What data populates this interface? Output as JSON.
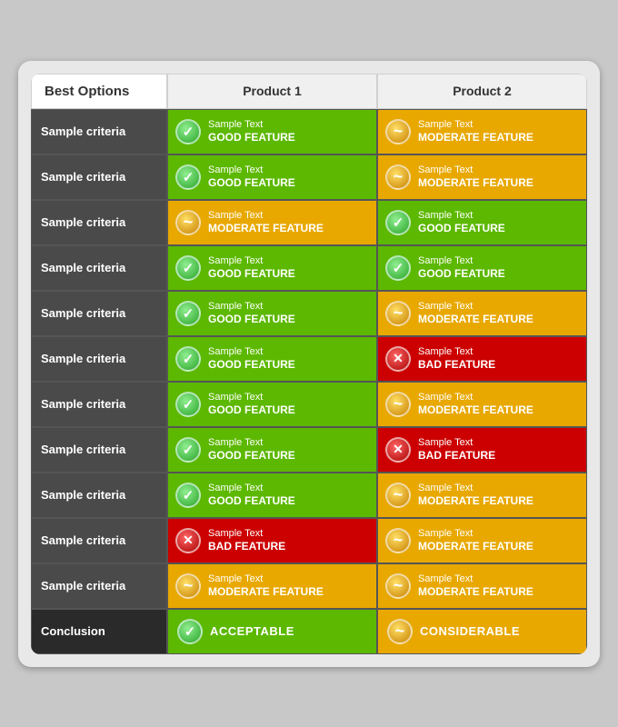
{
  "header": {
    "col1": "Best Options",
    "col2": "Product 1",
    "col3": "Product 2"
  },
  "rows": [
    {
      "criteria": "Sample criteria",
      "p1": {
        "type": "good",
        "text": "Sample Text",
        "label": "GOOD FEATURE"
      },
      "p2": {
        "type": "moderate",
        "text": "Sample Text",
        "label": "MODERATE FEATURE"
      }
    },
    {
      "criteria": "Sample criteria",
      "p1": {
        "type": "good",
        "text": "Sample Text",
        "label": "GOOD FEATURE"
      },
      "p2": {
        "type": "moderate",
        "text": "Sample Text",
        "label": "MODERATE FEATURE"
      }
    },
    {
      "criteria": "Sample criteria",
      "p1": {
        "type": "moderate",
        "text": "Sample Text",
        "label": "MODERATE FEATURE"
      },
      "p2": {
        "type": "good",
        "text": "Sample Text",
        "label": "GOOD FEATURE"
      }
    },
    {
      "criteria": "Sample criteria",
      "p1": {
        "type": "good",
        "text": "Sample Text",
        "label": "GOOD FEATURE"
      },
      "p2": {
        "type": "good",
        "text": "Sample Text",
        "label": "GOOD FEATURE"
      }
    },
    {
      "criteria": "Sample criteria",
      "p1": {
        "type": "good",
        "text": "Sample Text",
        "label": "GOOD FEATURE"
      },
      "p2": {
        "type": "moderate",
        "text": "Sample Text",
        "label": "MODERATE FEATURE"
      }
    },
    {
      "criteria": "Sample criteria",
      "p1": {
        "type": "good",
        "text": "Sample Text",
        "label": "GOOD FEATURE"
      },
      "p2": {
        "type": "bad",
        "text": "Sample Text",
        "label": "BAD FEATURE"
      }
    },
    {
      "criteria": "Sample criteria",
      "p1": {
        "type": "good",
        "text": "Sample Text",
        "label": "GOOD FEATURE"
      },
      "p2": {
        "type": "moderate",
        "text": "Sample Text",
        "label": "MODERATE FEATURE"
      }
    },
    {
      "criteria": "Sample criteria",
      "p1": {
        "type": "good",
        "text": "Sample Text",
        "label": "GOOD FEATURE"
      },
      "p2": {
        "type": "bad",
        "text": "Sample Text",
        "label": "BAD FEATURE"
      }
    },
    {
      "criteria": "Sample criteria",
      "p1": {
        "type": "good",
        "text": "Sample Text",
        "label": "GOOD FEATURE"
      },
      "p2": {
        "type": "moderate",
        "text": "Sample Text",
        "label": "MODERATE FEATURE"
      }
    },
    {
      "criteria": "Sample criteria",
      "p1": {
        "type": "bad",
        "text": "Sample Text",
        "label": "BAD FEATURE"
      },
      "p2": {
        "type": "moderate",
        "text": "Sample Text",
        "label": "MODERATE FEATURE"
      }
    },
    {
      "criteria": "Sample criteria",
      "p1": {
        "type": "moderate",
        "text": "Sample Text",
        "label": "MODERATE FEATURE"
      },
      "p2": {
        "type": "moderate",
        "text": "Sample Text",
        "label": "MODERATE FEATURE"
      }
    }
  ],
  "conclusion": {
    "label": "Conclusion",
    "p1": {
      "type": "good",
      "label": "ACCEPTABLE"
    },
    "p2": {
      "type": "moderate",
      "label": "CONSIDERABLE"
    }
  },
  "icons": {
    "good": "✓",
    "moderate": "~",
    "bad": "✕"
  },
  "colors": {
    "good": "green",
    "moderate": "yellow",
    "bad": "red"
  }
}
